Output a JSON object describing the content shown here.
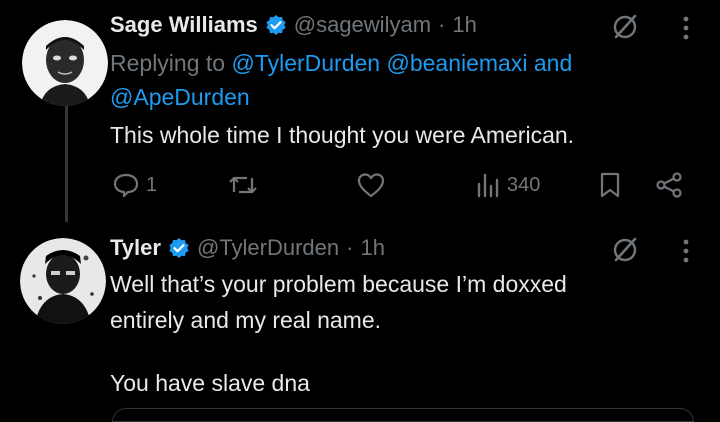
{
  "tweets": [
    {
      "name": "Sage Williams",
      "handle": "@sagewilyam",
      "time": "1h",
      "reply_prefix": "Replying to",
      "reply_mentions": [
        "@TylerDurden",
        "@beaniemaxi"
      ],
      "reply_and": "and",
      "reply_last": "@ApeDurden",
      "text": "This whole time I thought you were American.",
      "replies": "1",
      "views": "340"
    },
    {
      "name": "Tyler",
      "handle": "@TylerDurden",
      "time": "1h",
      "text_lines": [
        "Well that’s your problem because I’m doxxed",
        "entirely and my real name.",
        "",
        "You have slave dna"
      ]
    }
  ],
  "dot_separator": "·",
  "colors": {
    "accent": "#1d9bf0",
    "muted": "#71767b",
    "text": "#e7e9ea",
    "background": "#000000"
  },
  "icons": [
    "grok-icon",
    "more-icon",
    "reply-icon",
    "retweet-icon",
    "like-icon",
    "views-icon",
    "bookmark-icon",
    "share-icon",
    "verified-icon"
  ]
}
